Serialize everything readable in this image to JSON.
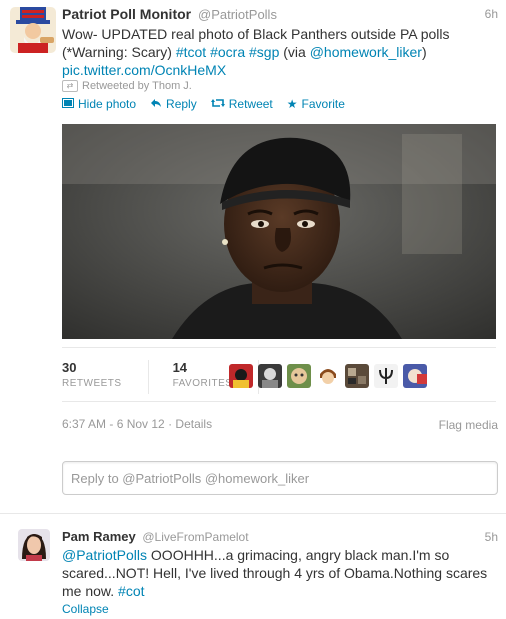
{
  "main_tweet": {
    "fullname": "Patriot Poll Monitor",
    "handle": "@PatriotPolls",
    "time": "6h",
    "text_line1": "Wow- UPDATED real photo of Black Panthers outside PA polls",
    "text_line2_pre": "(*Warning: Scary) ",
    "hashtag_tcot": "#tcot",
    "hashtag_ocra": "#ocra",
    "hashtag_sgp": "#sgp",
    "via_pre": " (via ",
    "via_user": "@homework_liker",
    "via_post": ")",
    "pic_link": "pic.twitter.com/OcnkHeMX",
    "retweeted_by": "Retweeted by Thom J.",
    "actions": {
      "hide_photo": "Hide photo",
      "reply": "Reply",
      "retweet": "Retweet",
      "favorite": "Favorite"
    },
    "stats": {
      "retweets_count": "30",
      "retweets_label": "RETWEETS",
      "favorites_count": "14",
      "favorites_label": "FAVORITES"
    },
    "timestamp": "6:37 AM - 6 Nov 12",
    "details": "Details",
    "flag_media": "Flag media"
  },
  "reply_box": {
    "placeholder": "Reply to @PatriotPolls @homework_liker"
  },
  "reply_tweet": {
    "fullname": "Pam Ramey",
    "handle": "@LiveFromPamelot",
    "time": "5h",
    "mention": "@PatriotPolls",
    "text_body": " OOOHHH...a grimacing, angry black man.I'm so scared...NOT! Hell, I've lived through 4 yrs of Obama.Nothing scares me now. ",
    "hashtag": "#cot",
    "collapse": "Collapse"
  },
  "colors": {
    "link": "#0084b4",
    "muted": "#999999",
    "text": "#333333"
  }
}
